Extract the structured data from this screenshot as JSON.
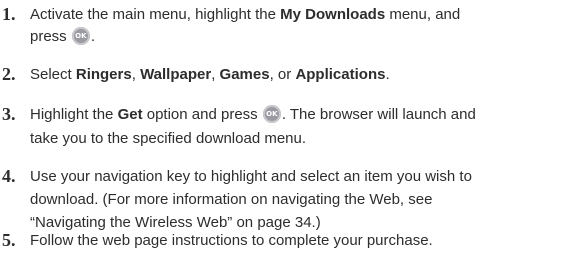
{
  "steps": [
    {
      "number": "1.",
      "lines": [
        {
          "parts": [
            {
              "text": "Activate the main menu, highlight the "
            },
            {
              "text": "My Downloads",
              "bold": true
            },
            {
              "text": " menu, and"
            }
          ]
        },
        {
          "parts": [
            {
              "text": "press "
            },
            {
              "icon": "ok-button-icon",
              "label": "OK"
            },
            {
              "text": "."
            }
          ]
        }
      ]
    },
    {
      "number": "2.",
      "lines": [
        {
          "parts": [
            {
              "text": "Select "
            },
            {
              "text": "Ringers",
              "bold": true
            },
            {
              "text": ", "
            },
            {
              "text": "Wallpaper",
              "bold": true
            },
            {
              "text": ", "
            },
            {
              "text": "Games",
              "bold": true
            },
            {
              "text": ", or "
            },
            {
              "text": "Applications",
              "bold": true
            },
            {
              "text": "."
            }
          ]
        }
      ]
    },
    {
      "number": "3.",
      "lines": [
        {
          "parts": [
            {
              "text": "Highlight the "
            },
            {
              "text": "Get",
              "bold": true
            },
            {
              "text": " option and press "
            },
            {
              "icon": "ok-button-icon",
              "label": "OK"
            },
            {
              "text": ". The browser will launch and"
            }
          ]
        },
        {
          "parts": [
            {
              "text": "take you to the specified download menu."
            }
          ]
        }
      ]
    },
    {
      "number": "4.",
      "lines": [
        {
          "parts": [
            {
              "text": "Use your navigation key to highlight and select an item you wish to"
            }
          ]
        },
        {
          "parts": [
            {
              "text": "download. (For more information on navigating the Web, see"
            }
          ]
        },
        {
          "parts": [
            {
              "text": "“Navigating the Wireless Web” on page 34.)"
            }
          ]
        }
      ]
    },
    {
      "number": "5.",
      "lines": [
        {
          "parts": [
            {
              "text": "Follow the web page instructions to complete your purchase."
            }
          ]
        }
      ]
    }
  ]
}
